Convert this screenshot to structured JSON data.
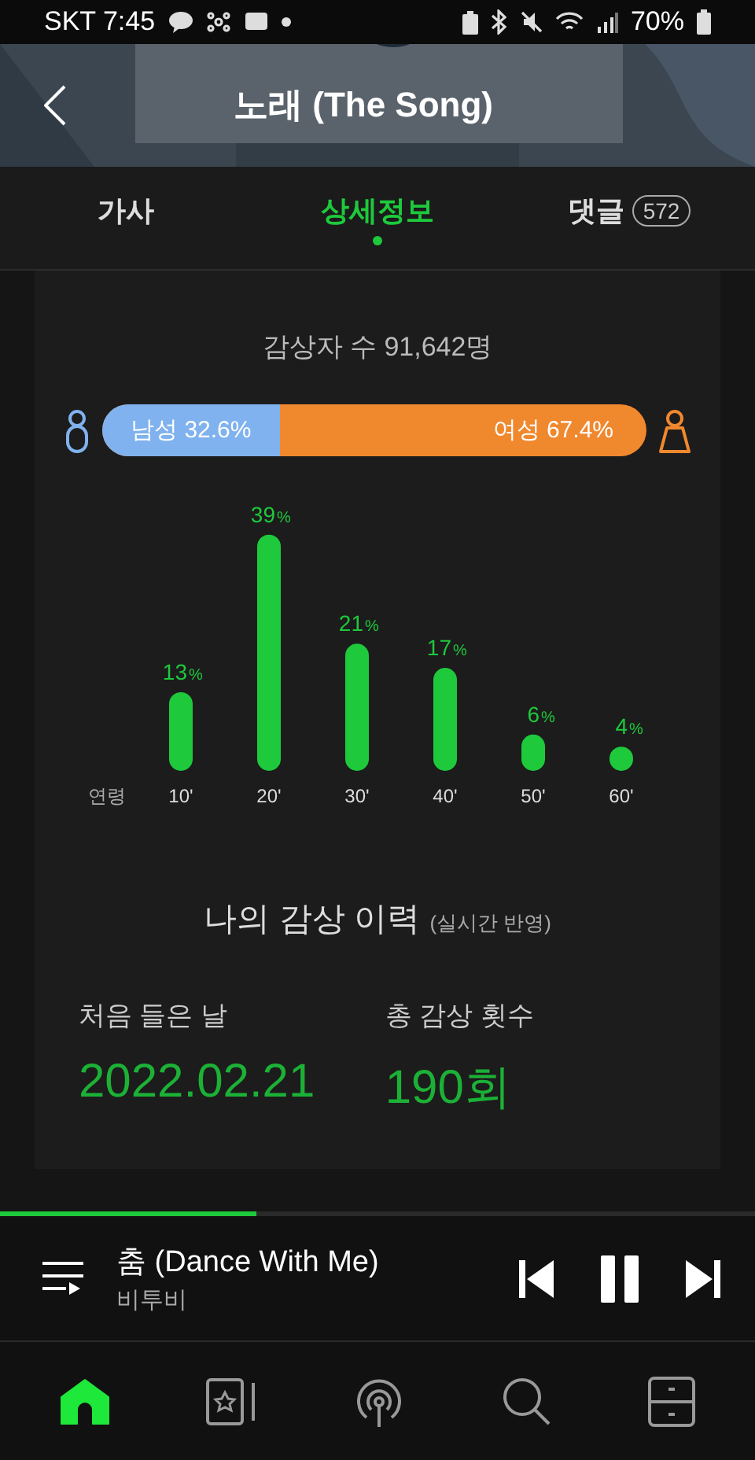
{
  "status_bar": {
    "carrier_time": "SKT 7:45",
    "battery": "70%"
  },
  "header": {
    "title": "노래 (The Song)"
  },
  "tabs": [
    {
      "label": "가사",
      "selected": false
    },
    {
      "label": "상세정보",
      "selected": true
    },
    {
      "label": "댓글",
      "badge": "572",
      "selected": false
    }
  ],
  "listeners": "감상자 수 91,642명",
  "gender": {
    "male": {
      "label": "남성 32.6%",
      "level": 0.326
    },
    "female": {
      "label": "여성 67.4%"
    }
  },
  "age_chart": {
    "value_unit": "%",
    "chart_data": {
      "type": "bar",
      "xlabel": "연령",
      "categories": [
        "10'",
        "20'",
        "30'",
        "40'",
        "50'",
        "60'"
      ],
      "series": [
        {
          "color": "#1ec93c",
          "values": [
            13,
            39,
            21,
            17,
            6,
            4
          ]
        }
      ],
      "data_labels": true
    }
  },
  "history": {
    "title": "나의 감상 이력",
    "note": "(실시간 반영)",
    "items": [
      {
        "label": "처음 들은 날",
        "value": "2022.02.21"
      },
      {
        "label": "총 감상 횟수",
        "value": "190회"
      }
    ]
  },
  "player": {
    "level": 0.34,
    "title": "춤 (Dance With Me)",
    "artist": "비투비",
    "playing": true
  },
  "nav": [
    {
      "kind": "home",
      "selected": true
    },
    {
      "kind": "library",
      "selected": false
    },
    {
      "kind": "podcast",
      "selected": false
    },
    {
      "kind": "search",
      "selected": false
    },
    {
      "kind": "storage",
      "selected": false
    }
  ]
}
